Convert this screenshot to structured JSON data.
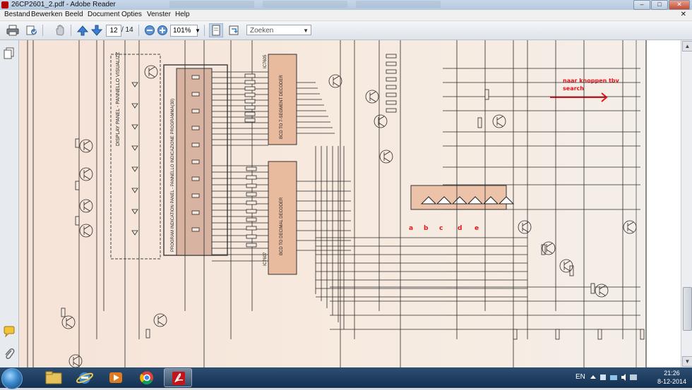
{
  "window": {
    "title": "26CP2601_2.pdf - Adobe Reader",
    "minimize_label": "–",
    "maximize_label": "□",
    "close_label": "✕"
  },
  "menu": {
    "items": [
      "Bestand",
      "Bewerken",
      "Beeld",
      "Document",
      "Opties",
      "Venster",
      "Help"
    ],
    "close_doc": "✕"
  },
  "toolbar": {
    "page_current": "12",
    "page_total": "/ 14",
    "zoom": "101%",
    "search_placeholder": "Zoeken"
  },
  "schematic": {
    "labels": [
      "a",
      "b",
      "c",
      "d",
      "e"
    ],
    "annotation_line1": "naar knoppen tbv",
    "annotation_line2": "search",
    "annotation_color": "#e8141c",
    "panel_labels": [
      "DISPLAY PANEL - PANNELLO VISUALIZZ",
      "PROGRAM INDICATION PANEL - PANNELLO INDICAZIONE PROGRAMMA(30)"
    ],
    "ic_labels": [
      "BCD TO 7-SEGMENT DECODER",
      "BCD TO DECIMAL DECODER"
    ],
    "ic_ref1": "IC7605",
    "ic_ref2": "IC7607",
    "line_color": "#2a2a2a"
  },
  "taskbar": {
    "language": "EN",
    "time": "21:26",
    "date": "8-12-2014"
  }
}
